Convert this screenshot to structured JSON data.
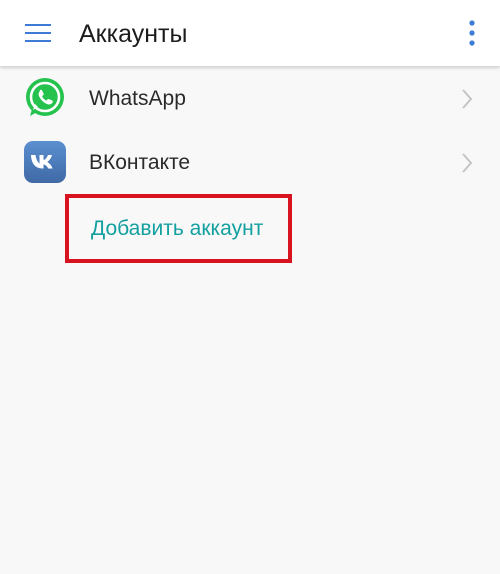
{
  "header": {
    "title": "Аккаунты",
    "menu_icon": "hamburger-menu-icon",
    "more_icon": "more-vertical-icon"
  },
  "accounts": [
    {
      "label": "WhatsApp",
      "icon": "whatsapp-icon"
    },
    {
      "label": "ВКонтакте",
      "icon": "vk-icon"
    }
  ],
  "add_account": {
    "label": "Добавить аккаунт"
  },
  "colors": {
    "accent_blue": "#3d7bd6",
    "link_teal": "#14a0a0",
    "highlight_red": "#d7131f",
    "whatsapp_green": "#25c24d",
    "vk_blue": "#4a76a8"
  }
}
